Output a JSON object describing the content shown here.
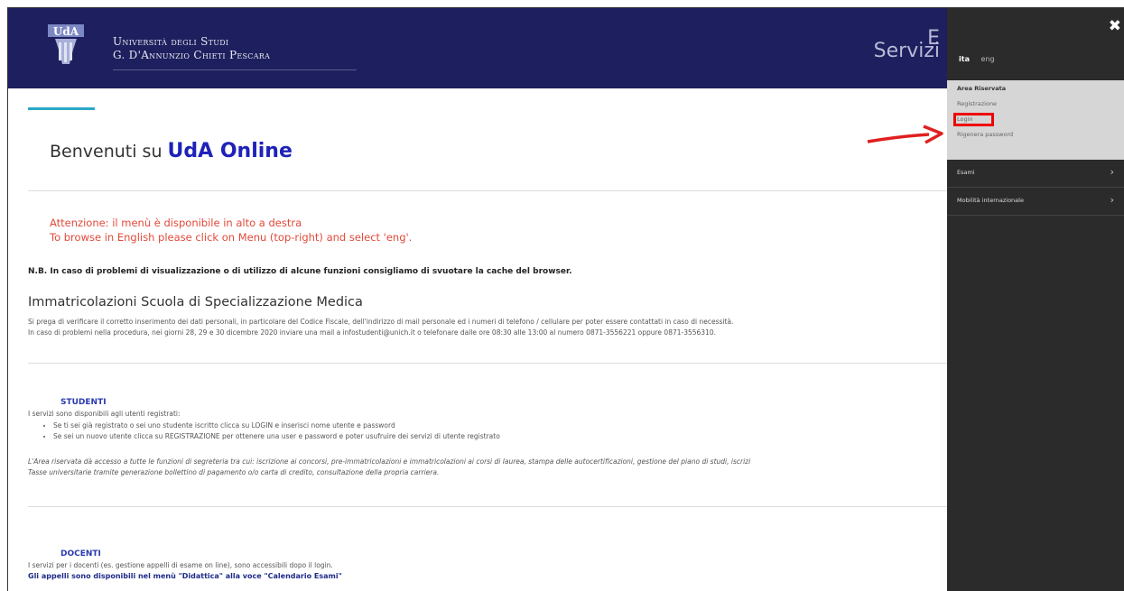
{
  "header": {
    "uni_line1": "Università degli Studi",
    "uni_line2": "G. D'Annunzio Chieti Pescara",
    "title_partial1": "E",
    "title_partial2": "Servizi"
  },
  "main": {
    "welcome_prefix": "Benvenuti su ",
    "welcome_brand": "UdA Online",
    "attention_line1": "Attenzione: il menù è disponibile in alto a destra",
    "attention_line2": "To browse in English please click on Menu (top-right) and select 'eng'.",
    "nb": "N.B. In caso di problemi di visualizzazione o di utilizzo di alcune funzioni consigliamo di svuotare la cache del browser.",
    "immat_title": "Immatricolazioni Scuola di Specializzazione Medica",
    "immat_text1": "Si prega di verificare il corretto inserimento dei dati personali, in particolare del Codice Fiscale, dell'indirizzo di mail personale ed i numeri di telefono / cellulare per poter essere contattati in caso di necessità.",
    "immat_text2": "In caso di problemi nella procedura, nei giorni 28, 29 e 30 dicembre 2020 inviare una mail a infostudenti@unich.it o telefonare dalle ore 08:30 alle 13:00 al numero 0871-3556221 oppure 0871-3556310.",
    "students_title": "STUDENTI",
    "students_intro": "I servizi sono disponibili agli utenti registrati:",
    "students_item1": "Se ti sei già registrato o sei uno studente iscritto clicca su LOGIN e inserisci nome utente e password",
    "students_item2": "Se sei un nuovo utente clicca su REGISTRAZIONE per ottenere una user e password e poter usufruire dei servizi di utente registrato",
    "students_area1": "L'Area riservata dà accesso a tutte le funzioni di segreteria tra cui: iscrizione ai concorsi, pre-immatricolazioni e immatricolazioni ai corsi di laurea, stampa delle autocertificazioni, gestione del piano di studi, iscrizi",
    "students_area2": "Tasse universitarie tramite generazione bollettino di pagamento o/o carta di credito, consultazione della propria carriera.",
    "docenti_title": "DOCENTI",
    "docenti_text": "I servizi per i docenti (es. gestione appelli di esame on line), sono accessibili dopo il login.",
    "docenti_note": "Gli appelli sono disponibili nel menù \"Didattica\" alla voce \"Calendario Esami\""
  },
  "sidebar": {
    "close_label": "✖",
    "lang_ita": "ita",
    "lang_eng": "eng",
    "area_title": "Area Riservata",
    "area_items": [
      "Registrazione",
      "Login",
      "Rigenera password"
    ],
    "menu_items": [
      {
        "label": "Esami",
        "chevron": "›"
      },
      {
        "label": "Mobilità internazionale",
        "chevron": "›"
      }
    ]
  },
  "colors": {
    "header_bg": "#1d1f5e",
    "sidebar_bg": "#2b2b2b",
    "brand": "#1e22b8",
    "attention": "#e24a3a",
    "highlight": "#e00000"
  }
}
